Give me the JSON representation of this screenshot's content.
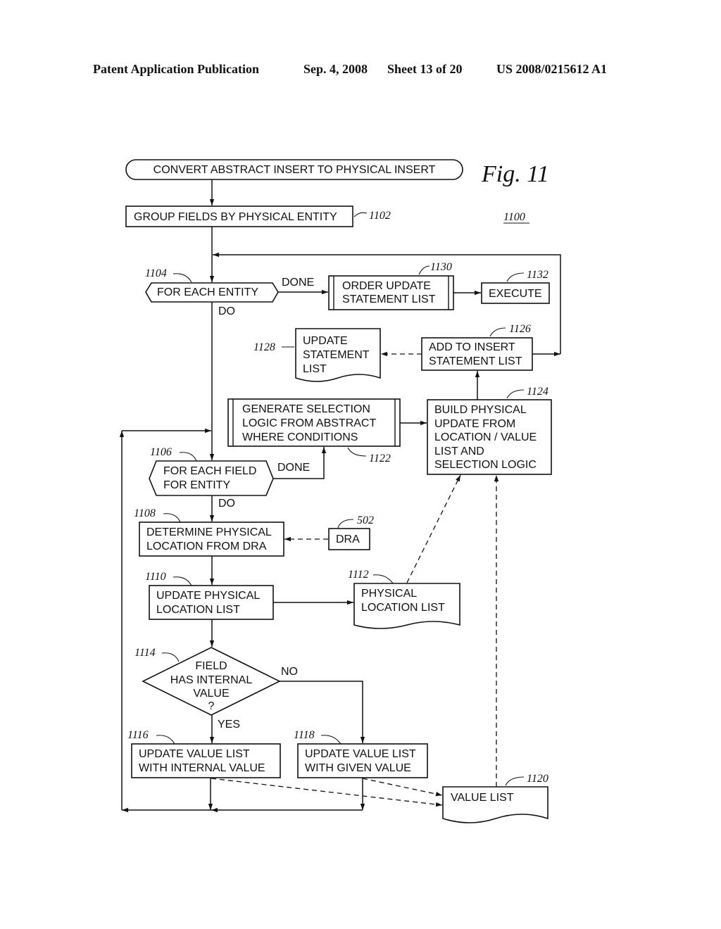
{
  "header": {
    "publication": "Patent Application Publication",
    "date": "Sep. 4, 2008",
    "sheet": "Sheet 13 of 20",
    "number": "US 2008/0215612 A1"
  },
  "figure": {
    "label": "Fig.  11",
    "ref": "1100"
  },
  "nodes": {
    "start": {
      "lines": [
        "CONVERT ABSTRACT INSERT TO PHYSICAL INSERT"
      ]
    },
    "n1102": {
      "ref": "1102",
      "lines": [
        "GROUP FIELDS BY PHYSICAL ENTITY"
      ]
    },
    "n1104": {
      "ref": "1104",
      "lines": [
        "FOR EACH ENTITY"
      ]
    },
    "n1130": {
      "ref": "1130",
      "lines": [
        "ORDER UPDATE",
        "STATEMENT LIST"
      ]
    },
    "n1132": {
      "ref": "1132",
      "lines": [
        "EXECUTE"
      ]
    },
    "n1128": {
      "ref": "1128",
      "lines": [
        "UPDATE",
        "STATEMENT",
        "LIST"
      ]
    },
    "n1126": {
      "ref": "1126",
      "lines": [
        "ADD TO INSERT",
        "STATEMENT LIST"
      ]
    },
    "n1122": {
      "ref": "1122",
      "lines": [
        "GENERATE SELECTION",
        "LOGIC FROM ABSTRACT",
        "WHERE CONDITIONS"
      ]
    },
    "n1124": {
      "ref": "1124",
      "lines": [
        "BUILD PHYSICAL",
        "UPDATE FROM",
        "LOCATION / VALUE",
        "LIST AND",
        "SELECTION LOGIC"
      ]
    },
    "n1106": {
      "ref": "1106",
      "lines": [
        "FOR EACH FIELD",
        "FOR ENTITY"
      ]
    },
    "n1108": {
      "ref": "1108",
      "lines": [
        "DETERMINE PHYSICAL",
        "LOCATION FROM DRA"
      ]
    },
    "n502": {
      "ref": "502",
      "lines": [
        "DRA"
      ]
    },
    "n1110": {
      "ref": "1110",
      "lines": [
        "UPDATE PHYSICAL",
        "LOCATION LIST"
      ]
    },
    "n1112": {
      "ref": "1112",
      "lines": [
        "PHYSICAL",
        "LOCATION LIST"
      ]
    },
    "n1114": {
      "ref": "1114",
      "lines": [
        "FIELD",
        "HAS INTERNAL",
        "VALUE",
        "?"
      ]
    },
    "n1116": {
      "ref": "1116",
      "lines": [
        "UPDATE VALUE LIST",
        "WITH INTERNAL VALUE"
      ]
    },
    "n1118": {
      "ref": "1118",
      "lines": [
        "UPDATE VALUE LIST",
        "WITH GIVEN VALUE"
      ]
    },
    "n1120": {
      "ref": "1120",
      "lines": [
        "VALUE LIST"
      ]
    }
  },
  "edge_labels": {
    "entity_done": "DONE",
    "entity_do": "DO",
    "field_done": "DONE",
    "field_do": "DO",
    "decision_no": "NO",
    "decision_yes": "YES"
  }
}
